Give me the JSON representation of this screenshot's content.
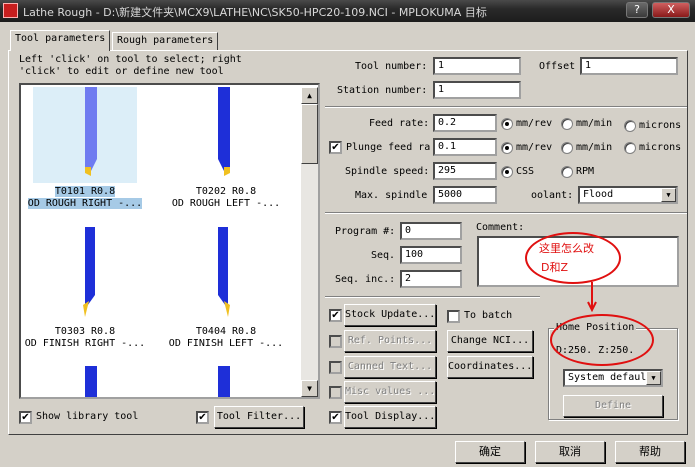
{
  "window": {
    "title": "Lathe Rough - D:\\新建文件夹\\MCX9\\LATHE\\NC\\SK50-HPC20-109.NCI - MPLOKUMA 目标",
    "help_glyph": "?",
    "close_glyph": "X"
  },
  "tabs": [
    {
      "label": "Tool parameters"
    },
    {
      "label": "Rough parameters"
    }
  ],
  "hint": {
    "line1": "Left 'click' on tool to select; right",
    "line2": "'click' to edit or define new tool"
  },
  "tools": [
    {
      "number": "T0101 R0.8",
      "desc": "OD ROUGH RIGHT -..."
    },
    {
      "number": "T0202 R0.8",
      "desc": "OD ROUGH LEFT -..."
    },
    {
      "number": "T0303 R0.8",
      "desc": "OD FINISH RIGHT -..."
    },
    {
      "number": "T0404 R0.8",
      "desc": "OD FINISH LEFT -..."
    }
  ],
  "tool_colors": {
    "body": "#1e2fd8",
    "selected_body": "#6f7bf0",
    "insert": "#f0c020"
  },
  "fields": {
    "tool_number": {
      "label": "Tool number:",
      "value": "1"
    },
    "offset": {
      "label": "Offset",
      "value": "1"
    },
    "station_number": {
      "label": "Station number:",
      "value": "1"
    },
    "feed_rate": {
      "label": "Feed rate:",
      "value": "0.2"
    },
    "plunge_feed": {
      "label": "Plunge feed ra",
      "value": "0.1"
    },
    "spindle_speed": {
      "label": "Spindle speed:",
      "value": "295"
    },
    "max_spindle": {
      "label": "Max. spindle",
      "value": "5000"
    },
    "coolant": {
      "label": "oolant:",
      "value": "Flood"
    },
    "program_no": {
      "label": "Program #:",
      "value": "0"
    },
    "seq": {
      "label": "Seq.",
      "value": "100"
    },
    "seq_inc": {
      "label": "Seq. inc.:",
      "value": "2"
    },
    "comment": {
      "label": "Comment:"
    }
  },
  "radios": {
    "feed_mmrev": "mm/rev",
    "feed_mmmin": "mm/min",
    "feed_microns": "microns",
    "plunge_mmrev": "mm/rev",
    "plunge_mmmin": "mm/min",
    "plunge_microns": "microns",
    "css": "CSS",
    "rpm": "RPM"
  },
  "buttons": {
    "stock_update": "Stock Update...",
    "ref_points": "Ref. Points...",
    "canned_text": "Canned Text...",
    "misc_values": "Misc values ...",
    "tool_display": "Tool Display...",
    "to_batch": "To batch",
    "change_nci": "Change NCI...",
    "coordinates": "Coordinates...",
    "show_library": "Show library tool",
    "tool_filter": "Tool Filter...",
    "define": "Define",
    "ok": "确定",
    "cancel": "取消",
    "help": "帮助"
  },
  "home_position": {
    "label": "Home Position",
    "value": "D:250.  Z:250.",
    "mode": "System defaul"
  },
  "annotation": {
    "line1": "这里怎么改",
    "line2": "D和Z"
  },
  "check_glyph": "✔",
  "dropdown_glyph": "▼",
  "scroll_up_glyph": "▲",
  "scroll_down_glyph": "▼"
}
